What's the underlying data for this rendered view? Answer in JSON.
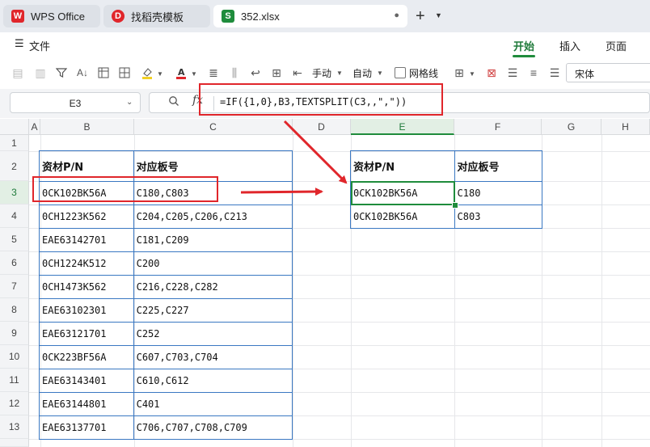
{
  "tabs": [
    {
      "label": "WPS Office",
      "logo": "W"
    },
    {
      "label": "找稻壳模板",
      "logo": "D"
    },
    {
      "label": "352.xlsx",
      "logo": "S",
      "close": "●"
    }
  ],
  "menu": {
    "file": "文件",
    "tabs": [
      "开始",
      "插入",
      "页面"
    ]
  },
  "toolbar": {
    "wrap": "手动",
    "auto": "自动",
    "gridlines": "网格线",
    "font": "宋体"
  },
  "formula": {
    "cell_ref": "E3",
    "fx": "fx",
    "text": "=IF({1,0},B3,TEXTSPLIT(C3,,\",\"))"
  },
  "columns": [
    "A",
    "B",
    "C",
    "D",
    "E",
    "F",
    "G",
    "H"
  ],
  "rows": [
    "1",
    "2",
    "3",
    "4",
    "5",
    "6",
    "7",
    "8",
    "9",
    "10",
    "11",
    "12",
    "13"
  ],
  "source_table": {
    "headers": [
      "资材P/N",
      "对应板号"
    ],
    "rows": [
      [
        "0CK102BK56A",
        "C180,C803"
      ],
      [
        "0CH1223K562",
        "C204,C205,C206,C213"
      ],
      [
        "EAE63142701",
        "C181,C209"
      ],
      [
        "0CH1224K512",
        "C200"
      ],
      [
        "0CH1473K562",
        "C216,C228,C282"
      ],
      [
        "EAE63102301",
        "C225,C227"
      ],
      [
        "EAE63121701",
        "C252"
      ],
      [
        "0CK223BF56A",
        "C607,C703,C704"
      ],
      [
        "EAE63143401",
        "C610,C612"
      ],
      [
        "EAE63144801",
        "C401"
      ],
      [
        "EAE63137701",
        "C706,C707,C708,C709"
      ]
    ]
  },
  "result_table": {
    "headers": [
      "资材P/N",
      "对应板号"
    ],
    "rows": [
      [
        "0CK102BK56A",
        "C180"
      ],
      [
        "0CK102BK56A",
        "C803"
      ]
    ]
  },
  "colors": {
    "accent": "#1f8c3c",
    "annotation": "#e0262b",
    "table_border": "#3a78c2"
  }
}
